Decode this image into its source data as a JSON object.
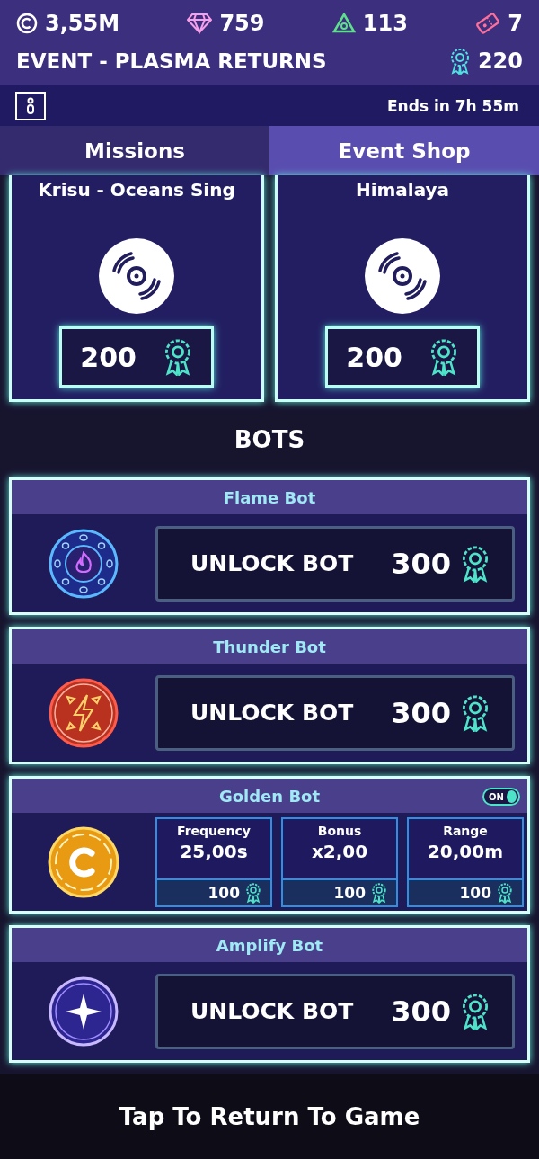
{
  "currencies": [
    {
      "value": "3,55M"
    },
    {
      "value": "759"
    },
    {
      "value": "113"
    },
    {
      "value": "7"
    }
  ],
  "event": {
    "title": "EVENT - PLASMA RETURNS",
    "points": "220",
    "ends": "Ends in 7h 55m"
  },
  "tabs": [
    {
      "label": "Missions",
      "selected": false
    },
    {
      "label": "Event Shop",
      "selected": true
    }
  ],
  "tracks": [
    {
      "title": "Krisu - Oceans Sing",
      "price": "200"
    },
    {
      "title": "Himalaya",
      "price": "200"
    }
  ],
  "bots_heading": "BOTS",
  "bots": [
    {
      "kind": "unlock",
      "name": "Flame Bot",
      "action": "UNLOCK BOT",
      "price": "300"
    },
    {
      "kind": "unlock",
      "name": "Thunder Bot",
      "action": "UNLOCK BOT",
      "price": "300"
    },
    {
      "kind": "upgrade",
      "name": "Golden Bot",
      "toggle_on": true,
      "toggle_label": "ON",
      "stats": [
        {
          "label": "Frequency",
          "value": "25,00s",
          "price": "100"
        },
        {
          "label": "Bonus",
          "value": "x2,00",
          "price": "100"
        },
        {
          "label": "Range",
          "value": "20,00m",
          "price": "100"
        }
      ]
    },
    {
      "kind": "unlock",
      "name": "Amplify Bot",
      "action": "UNLOCK BOT",
      "price": "300"
    }
  ],
  "footer": "Tap To Return To Game"
}
